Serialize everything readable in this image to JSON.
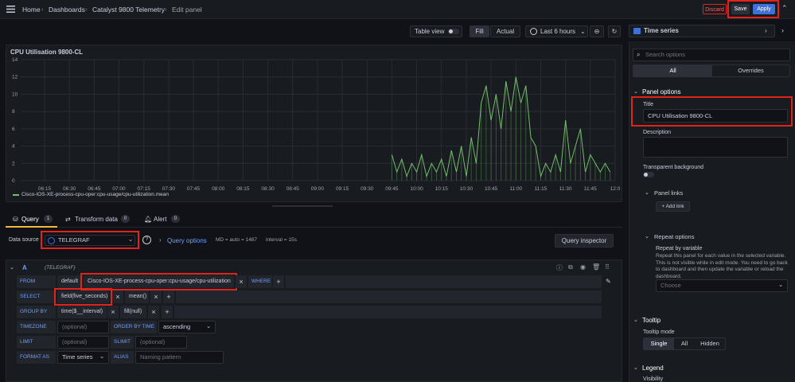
{
  "breadcrumb": {
    "home": "Home",
    "dashboards": "Dashboards",
    "dashboard": "Catalyst 9800 Telemetry",
    "current": "Edit panel"
  },
  "actions": {
    "discard": "Discard",
    "save": "Save",
    "apply": "Apply"
  },
  "toolbar": {
    "table_view": "Table view",
    "fill": "Fill",
    "actual": "Actual",
    "time_range": "Last 6 hours"
  },
  "viz": {
    "type": "Time series"
  },
  "chart_data": {
    "type": "line",
    "title": "CPU Utilisation 9800-CL",
    "xlabel": "",
    "ylabel": "",
    "ylim": [
      0,
      14
    ],
    "y_ticks": [
      "0",
      "2",
      "4",
      "6",
      "8",
      "10",
      "12",
      "14"
    ],
    "x_ticks": [
      "06:15",
      "06:30",
      "06:45",
      "07:00",
      "07:15",
      "07:30",
      "07:45",
      "08:00",
      "08:15",
      "08:30",
      "08:45",
      "09:00",
      "09:15",
      "09:30",
      "09:45",
      "10:00",
      "10:15",
      "10:30",
      "10:45",
      "11:00",
      "11:15",
      "11:30",
      "11:45",
      "12:0"
    ],
    "grid": true,
    "legend_position": "bottom-left",
    "series": [
      {
        "name": "Cisco-IOS-XE-process-cpu-oper:cpu-usage/cpu-utilization.mean",
        "color": "#73bf69",
        "x": [
          "09:45",
          "09:48",
          "09:51",
          "09:54",
          "09:57",
          "10:00",
          "10:03",
          "10:06",
          "10:09",
          "10:12",
          "10:15",
          "10:18",
          "10:21",
          "10:24",
          "10:27",
          "10:30",
          "10:33",
          "10:36",
          "10:39",
          "10:42",
          "10:45",
          "10:48",
          "10:51",
          "10:54",
          "10:57",
          "11:00",
          "11:03",
          "11:06",
          "11:09",
          "11:12",
          "11:15",
          "11:18",
          "11:21",
          "11:24",
          "11:27",
          "11:30",
          "11:33",
          "11:36",
          "11:39",
          "11:42",
          "11:45",
          "11:48",
          "11:51",
          "11:54",
          "11:57"
        ],
        "y": [
          3,
          1,
          2.5,
          0.5,
          2,
          1,
          3,
          0.5,
          2,
          1,
          2.5,
          0.5,
          3.5,
          1,
          4,
          0.5,
          5,
          2,
          9,
          11,
          7,
          10,
          6,
          11.5,
          8,
          12,
          9,
          11,
          5,
          4,
          0.5,
          2,
          1,
          3,
          1,
          7,
          2,
          4,
          6,
          1,
          3,
          2,
          1,
          2,
          1
        ]
      }
    ]
  },
  "tabs": {
    "query": {
      "label": "Query",
      "count": "1"
    },
    "transform": {
      "label": "Transform data",
      "count": "0"
    },
    "alert": {
      "label": "Alert",
      "count": "0"
    }
  },
  "datasource": {
    "label": "Data source",
    "value": "TELEGRAF",
    "query_options": "Query options",
    "md": "MD = auto = 1487",
    "interval": "interval = 15s",
    "inspector": "Query inspector"
  },
  "query": {
    "letter": "A",
    "ds_tag": "(TELEGRAF)",
    "from_label": "FROM",
    "from_db": "default",
    "from_measurement": "Cisco-IOS-XE-process-cpu-oper:cpu-usage/cpu-utilization",
    "where_label": "WHERE",
    "select_label": "SELECT",
    "select_field": "field(five_seconds)",
    "select_fn": "mean()",
    "groupby_label": "GROUP BY",
    "groupby_time": "time($__interval)",
    "groupby_fill": "fill(null)",
    "timezone_label": "TIMEZONE",
    "timezone_ph": "(optional)",
    "orderby_label": "ORDER BY TIME",
    "orderby_value": "ascending",
    "limit_label": "LIMIT",
    "limit_ph": "(optional)",
    "slimit_label": "SLIMIT",
    "slimit_ph": "(optional)",
    "format_label": "FORMAT AS",
    "format_value": "Time series",
    "alias_label": "ALIAS",
    "alias_ph": "Naming pattern",
    "plus": "+",
    "x": "×"
  },
  "options": {
    "search_ph": "Search options",
    "tab_all": "All",
    "tab_overrides": "Overrides",
    "panel_options": "Panel options",
    "title_label": "Title",
    "title_value": "CPU Utilisation 9800-CL",
    "description_label": "Description",
    "transparent_label": "Transparent background",
    "panel_links": "Panel links",
    "add_link": "Add link",
    "repeat_options": "Repeat options",
    "repeat_by": "Repeat by variable",
    "repeat_desc": "Repeat this panel for each value in the selected variable. This is not visible while in edit mode. You need to go back to dashboard and then update the variable or reload the dashboard.",
    "choose": "Choose",
    "tooltip": "Tooltip",
    "tooltip_mode": "Tooltip mode",
    "mode_single": "Single",
    "mode_all": "All",
    "mode_hidden": "Hidden",
    "legend": "Legend",
    "visibility": "Visibility"
  }
}
